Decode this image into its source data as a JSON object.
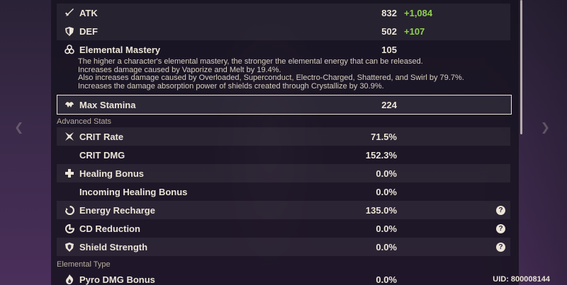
{
  "stats": {
    "atk": {
      "label": "ATK",
      "value": "832",
      "bonus": "+1,084"
    },
    "def": {
      "label": "DEF",
      "value": "502",
      "bonus": "+107"
    },
    "em": {
      "label": "Elemental Mastery",
      "value": "105"
    }
  },
  "em_description": [
    "The higher a character's elemental mastery, the stronger the elemental energy that can be released.",
    "Increases damage caused by Vaporize and Melt by 19.4%.",
    "Also increases damage caused by Overloaded, Superconduct, Electro-Charged, Shattered, and Swirl by 79.7%.",
    "Increases the damage absorption power of shields created through Crystallize by 30.9%."
  ],
  "max_stamina": {
    "label": "Max Stamina",
    "value": "224"
  },
  "sections": {
    "advanced": "Advanced Stats",
    "elemental": "Elemental Type"
  },
  "advanced_stats": {
    "crit_rate": {
      "label": "CRIT Rate",
      "value": "71.5%"
    },
    "crit_dmg": {
      "label": "CRIT DMG",
      "value": "152.3%"
    },
    "healing": {
      "label": "Healing Bonus",
      "value": "0.0%"
    },
    "incoming_healing": {
      "label": "Incoming Healing Bonus",
      "value": "0.0%"
    },
    "energy_recharge": {
      "label": "Energy Recharge",
      "value": "135.0%"
    },
    "cd_reduction": {
      "label": "CD Reduction",
      "value": "0.0%"
    },
    "shield_strength": {
      "label": "Shield Strength",
      "value": "0.0%"
    }
  },
  "elemental_stats": {
    "pyro": {
      "label": "Pyro DMG Bonus",
      "value": "0.0%"
    }
  },
  "help_glyph": "?",
  "uid": "UID: 800008144",
  "colors": {
    "bonus_green": "#8fd14f",
    "text": "#ece5d8"
  }
}
